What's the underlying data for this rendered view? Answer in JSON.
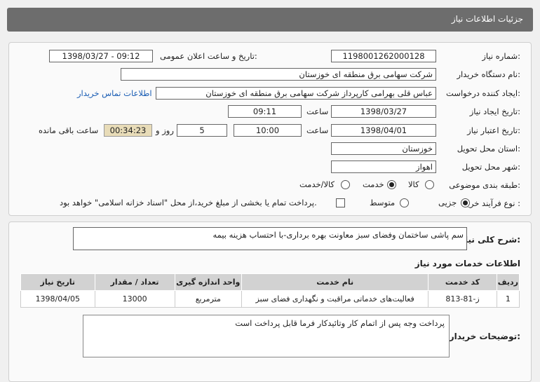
{
  "header": {
    "title": "جزئیات اطلاعات نیاز"
  },
  "form": {
    "need_number_label": "شماره نیاز:",
    "need_number": "1198001262000128",
    "announce_label": "تاریخ و ساعت اعلان عمومی:",
    "announce_value": "1398/03/27 - 09:12",
    "buyer_org_label": "نام دستگاه خریدار:",
    "buyer_org": "شرکت سهامی برق منطقه ای خوزستان",
    "requester_label": "ایجاد کننده درخواست:",
    "requester": "عباس قلی بهرامی کارپرداز شرکت سهامی برق منطقه ای خوزستان",
    "contact_link": "اطلاعات تماس خریدار",
    "create_date_label": "تاریخ ایجاد نیاز:",
    "create_date": "1398/03/27",
    "time_label": "ساعت",
    "create_time": "09:11",
    "validity_label": "تاریخ اعتبار نیاز:",
    "validity_date": "1398/04/01",
    "validity_time": "10:00",
    "days_value": "5",
    "days_label": "روز و",
    "remaining_time": "00:34:23",
    "remaining_label": "ساعت باقی مانده",
    "province_label": "استان محل تحویل:",
    "province": "خوزستان",
    "city_label": "شهر محل تحویل:",
    "city": "اهواز",
    "category_label": "طبقه بندی موضوعی:",
    "category_options": [
      "کالا",
      "خدمت",
      "کالا/خدمت"
    ],
    "category_selected": "خدمت",
    "process_label": "نوع فرآیند خرید :",
    "process_options": [
      "جزیی",
      "متوسط"
    ],
    "process_selected": "جزیی",
    "payment_note": "پرداخت تمام یا بخشی از مبلغ خرید،از محل \"اسناد خزانه اسلامی\" خواهد بود."
  },
  "summary": {
    "label": "شرح کلی نیاز:",
    "text": "سم پاشی ساختمان وفضای سبز معاونت بهره برداری-با احتساب هزینه بیمه"
  },
  "services": {
    "title": "اطلاعات خدمات مورد نیاز",
    "columns": [
      "ردیف",
      "کد خدمت",
      "نام خدمت",
      "واحد اندازه گیری",
      "تعداد / مقدار",
      "تاریخ نیاز"
    ],
    "rows": [
      [
        "1",
        "ز-81-813",
        "فعالیت‌های خدماتی مراقبت و نگهداری فضای سبز",
        "مترمربع",
        "13000",
        "1398/04/05"
      ]
    ]
  },
  "buyer_notes": {
    "label": "توضیحات خریدار:",
    "text": "پرداخت وجه پس از اتمام کار وتائیدکار فرما قابل پرداخت است"
  },
  "colors": {
    "header_bg": "#6d6d6d",
    "link": "#1a5db4",
    "remaining_bg": "#e8dcb8"
  }
}
